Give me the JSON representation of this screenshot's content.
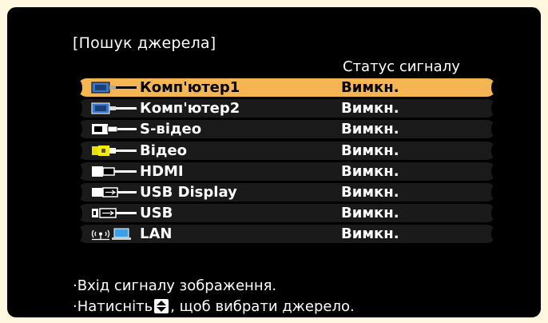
{
  "title": "[Пошук джерела]",
  "status_header": "Статус сигналу",
  "sources": [
    {
      "name": "Комп'ютер1",
      "status": "Вимкн.",
      "icon": "computer-port-icon",
      "selected": true
    },
    {
      "name": "Комп'ютер2",
      "status": "Вимкн.",
      "icon": "computer-port-icon",
      "selected": false
    },
    {
      "name": "S-відео",
      "status": "Вимкн.",
      "icon": "s-video-port-icon",
      "selected": false
    },
    {
      "name": "Відео",
      "status": "Вимкн.",
      "icon": "video-port-icon",
      "selected": false
    },
    {
      "name": "HDMI",
      "status": "Вимкн.",
      "icon": "hdmi-port-icon",
      "selected": false
    },
    {
      "name": "USB Display",
      "status": "Вимкн.",
      "icon": "usb-display-icon",
      "selected": false
    },
    {
      "name": "USB",
      "status": "Вимкн.",
      "icon": "usb-port-icon",
      "selected": false
    },
    {
      "name": "LAN",
      "status": "Вимкн.",
      "icon": "lan-wireless-icon",
      "selected": false
    }
  ],
  "hints": {
    "line1": "·Вхід сигналу зображення.",
    "line2_before": "·Натисніть",
    "line2_after": ", щоб вибрати джерело."
  },
  "colors": {
    "highlight": "#f4b552",
    "background": "#000000",
    "border": "#fff7e0"
  }
}
